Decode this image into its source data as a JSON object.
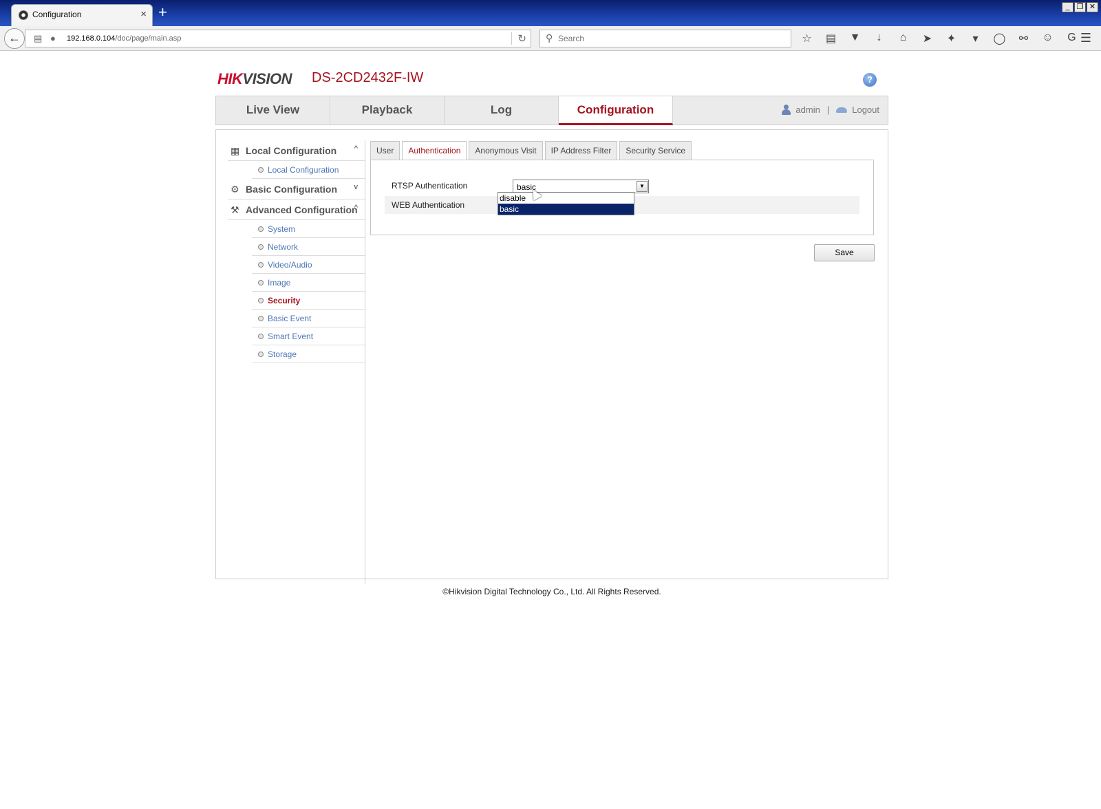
{
  "browser": {
    "tab_title": "Configuration",
    "tab_close": "×",
    "newtab": "+",
    "url_host": "192.168.0.104",
    "url_path": "/doc/page/main.asp",
    "search_placeholder": "Search",
    "window_buttons": [
      "_",
      "❐",
      "✕"
    ]
  },
  "header": {
    "logo_first": "HIK",
    "logo_rest": "VISION",
    "model": "DS-2CD2432F-IW",
    "help": "?"
  },
  "nav": {
    "tabs": [
      "Live View",
      "Playback",
      "Log",
      "Configuration"
    ],
    "user": "admin",
    "separator": "|",
    "logout": "Logout"
  },
  "sidebar": {
    "local": {
      "label": "Local Configuration",
      "chev": "^"
    },
    "local_items": [
      "Local Configuration"
    ],
    "basic": {
      "label": "Basic Configuration",
      "chev": "v"
    },
    "advanced": {
      "label": "Advanced Configuration",
      "chev": "^"
    },
    "advanced_items": [
      "System",
      "Network",
      "Video/Audio",
      "Image",
      "Security",
      "Basic Event",
      "Smart Event",
      "Storage"
    ]
  },
  "subtabs": [
    "User",
    "Authentication",
    "Anonymous Visit",
    "IP Address Filter",
    "Security Service"
  ],
  "form": {
    "rtsp_label": "RTSP Authentication",
    "rtsp_value": "basic",
    "rtsp_options": [
      "disable",
      "basic"
    ],
    "web_label": "WEB Authentication"
  },
  "save_label": "Save",
  "footer": "©Hikvision Digital Technology Co., Ltd. All Rights Reserved."
}
